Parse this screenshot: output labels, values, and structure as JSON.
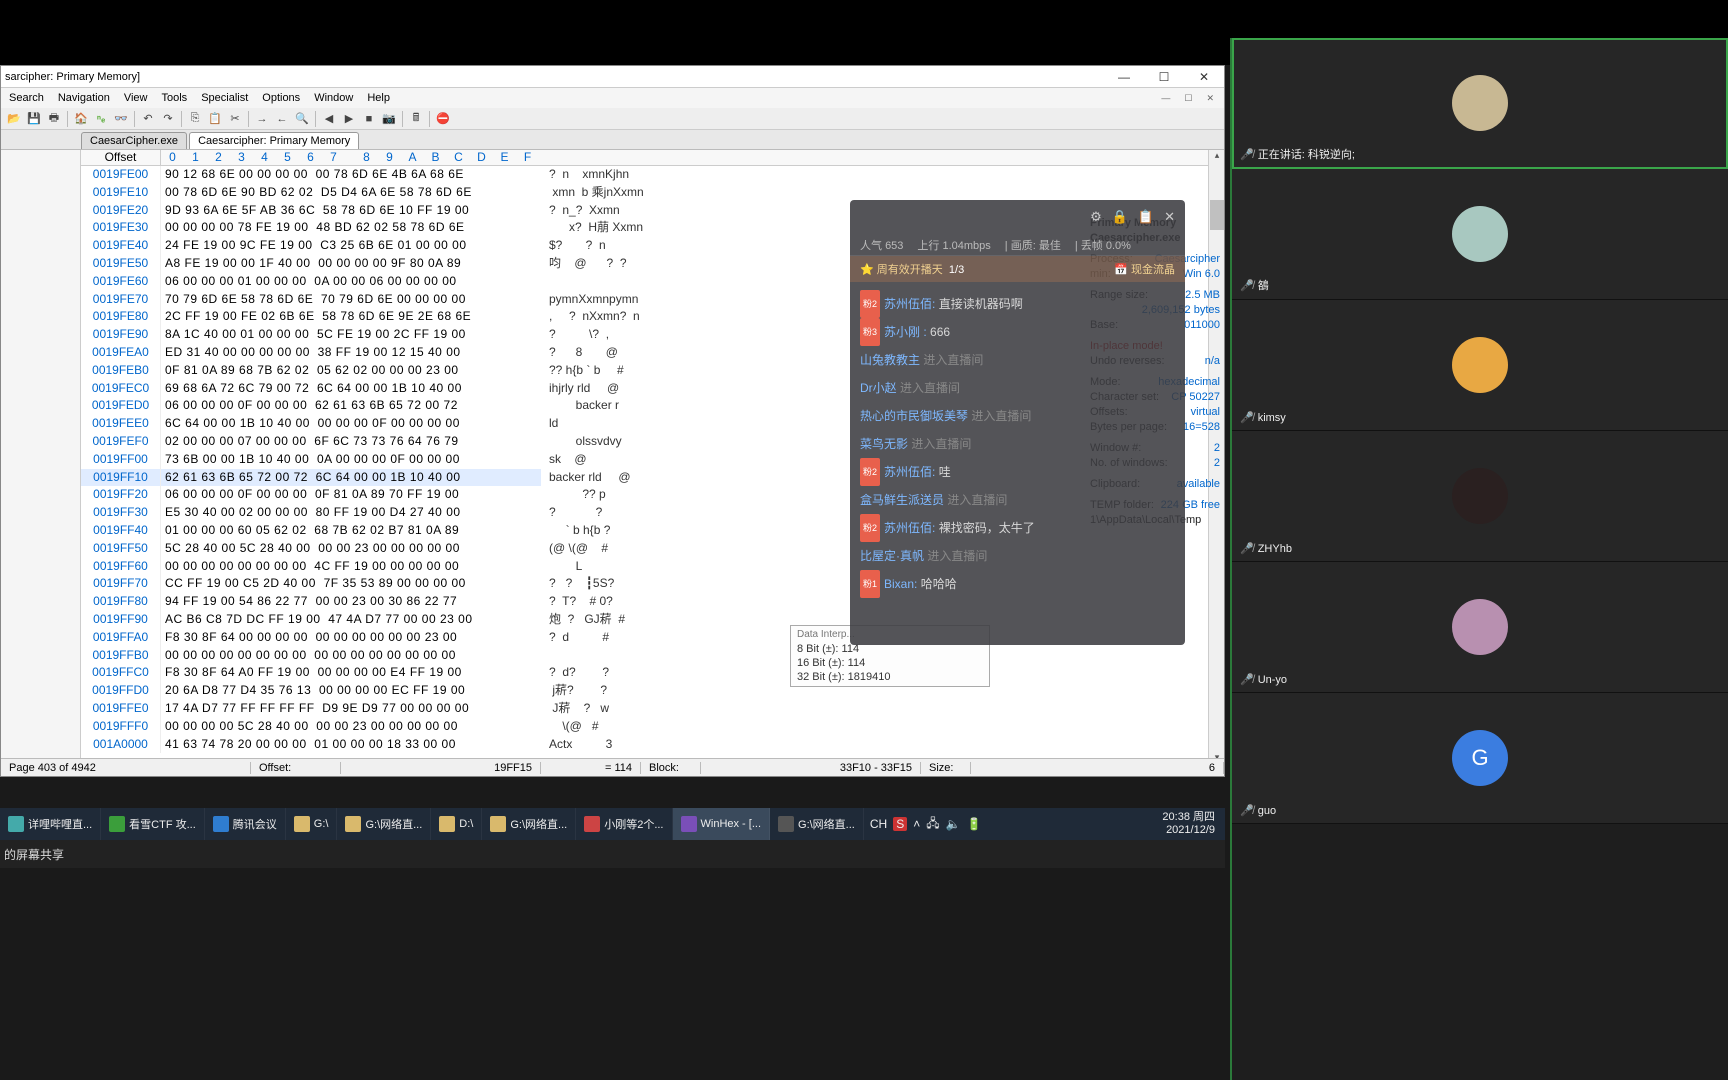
{
  "window": {
    "title": "sarcipher: Primary Memory]",
    "minimize": "—",
    "maximize": "☐",
    "close": "✕"
  },
  "menu": [
    "Search",
    "Navigation",
    "View",
    "Tools",
    "Specialist",
    "Options",
    "Window",
    "Help"
  ],
  "tabs": [
    {
      "label": "CaesarCipher.exe",
      "active": false
    },
    {
      "label": "Caesarcipher: Primary Memory",
      "active": true
    }
  ],
  "hex_header": {
    "offset": "Offset",
    "cols": [
      "0",
      "1",
      "2",
      "3",
      "4",
      "5",
      "6",
      "7",
      "8",
      "9",
      "A",
      "B",
      "C",
      "D",
      "E",
      "F"
    ]
  },
  "hex_rows": [
    {
      "off": "0019FE00",
      "b": "90 12 68 6E 00 00 00 00  00 78 6D 6E 4B 6A 68 6E",
      "a": "?  n    xmnKjhn"
    },
    {
      "off": "0019FE10",
      "b": "00 78 6D 6E 90 BD 62 02  D5 D4 6A 6E 58 78 6D 6E",
      "a": " xmn  b 乘jnXxmn"
    },
    {
      "off": "0019FE20",
      "b": "9D 93 6A 6E 5F AB 36 6C  58 78 6D 6E 10 FF 19 00",
      "a": "?  n_?  Xxmn"
    },
    {
      "off": "0019FE30",
      "b": "00 00 00 00 78 FE 19 00  48 BD 62 02 58 78 6D 6E",
      "a": "      x?  H萠 Xxmn"
    },
    {
      "off": "0019FE40",
      "b": "24 FE 19 00 9C FE 19 00  C3 25 6B 6E 01 00 00 00",
      "a": "$?       ?  n"
    },
    {
      "off": "0019FE50",
      "b": "A8 FE 19 00 00 1F 40 00  00 00 00 00 9F 80 0A 89",
      "a": "呁    @      ?  ?"
    },
    {
      "off": "0019FE60",
      "b": "06 00 00 00 01 00 00 00  0A 00 00 06 00 00 00 00",
      "a": ""
    },
    {
      "off": "0019FE70",
      "b": "70 79 6D 6E 58 78 6D 6E  70 79 6D 6E 00 00 00 00",
      "a": "pymnXxmnpymn"
    },
    {
      "off": "0019FE80",
      "b": "2C FF 19 00 FE 02 6B 6E  58 78 6D 6E 9E 2E 68 6E",
      "a": ",     ?  nXxmn?  n"
    },
    {
      "off": "0019FE90",
      "b": "8A 1C 40 00 01 00 00 00  5C FE 19 00 2C FF 19 00",
      "a": "?          \\?  ,"
    },
    {
      "off": "0019FEA0",
      "b": "ED 31 40 00 00 00 00 00  38 FF 19 00 12 15 40 00",
      "a": "?      8       @"
    },
    {
      "off": "0019FEB0",
      "b": "0F 81 0A 89 68 7B 62 02  05 62 02 00 00 00 23 00",
      "a": "?? h{b ` b     #"
    },
    {
      "off": "0019FEC0",
      "b": "69 68 6A 72 6C 79 00 72  6C 64 00 00 1B 10 40 00",
      "a": "ihjrly rld     @"
    },
    {
      "off": "0019FED0",
      "b": "06 00 00 00 0F 00 00 00  62 61 63 6B 65 72 00 72",
      "a": "        backer r"
    },
    {
      "off": "0019FEE0",
      "b": "6C 64 00 00 1B 10 40 00  00 00 00 0F 00 00 00 00",
      "a": "ld"
    },
    {
      "off": "0019FEF0",
      "b": "02 00 00 00 07 00 00 00  6F 6C 73 73 76 64 76 79",
      "a": "        olssvdvy"
    },
    {
      "off": "0019FF00",
      "b": "73 6B 00 00 1B 10 40 00  0A 00 00 00 0F 00 00 00",
      "a": "sk    @"
    },
    {
      "off": "0019FF10",
      "b": "62 61 63 6B 65 72 00 72  6C 64 00 00 1B 10 40 00",
      "a": "backer rld     @",
      "sel": true
    },
    {
      "off": "0019FF20",
      "b": "06 00 00 00 0F 00 00 00  0F 81 0A 89 70 FF 19 00",
      "a": "          ?? p"
    },
    {
      "off": "0019FF30",
      "b": "E5 30 40 00 02 00 00 00  80 FF 19 00 D4 27 40 00",
      "a": "?            ?"
    },
    {
      "off": "0019FF40",
      "b": "01 00 00 00 60 05 62 02  68 7B 62 02 B7 81 0A 89",
      "a": "     ` b h{b ?"
    },
    {
      "off": "0019FF50",
      "b": "5C 28 40 00 5C 28 40 00  00 00 23 00 00 00 00 00",
      "a": "(@ \\(@    #"
    },
    {
      "off": "0019FF60",
      "b": "00 00 00 00 00 00 00 00  4C FF 19 00 00 00 00 00",
      "a": "        L"
    },
    {
      "off": "0019FF70",
      "b": "CC FF 19 00 C5 2D 40 00  7F 35 53 89 00 00 00 00",
      "a": "?   ?    ┇5S?"
    },
    {
      "off": "0019FF80",
      "b": "94 FF 19 00 54 86 22 77  00 00 23 00 30 86 22 77",
      "a": "?  T?    # 0?"
    },
    {
      "off": "0019FF90",
      "b": "AC B6 C8 7D DC FF 19 00  47 4A D7 77 00 00 23 00",
      "a": "炮  ?   GJ菥  #"
    },
    {
      "off": "0019FFA0",
      "b": "F8 30 8F 64 00 00 00 00  00 00 00 00 00 00 23 00",
      "a": "?  d          #"
    },
    {
      "off": "0019FFB0",
      "b": "00 00 00 00 00 00 00 00  00 00 00 00 00 00 00 00",
      "a": ""
    },
    {
      "off": "0019FFC0",
      "b": "F8 30 8F 64 A0 FF 19 00  00 00 00 00 E4 FF 19 00",
      "a": "?  d?        ?"
    },
    {
      "off": "0019FFD0",
      "b": "20 6A D8 77 D4 35 76 13  00 00 00 00 EC FF 19 00",
      "a": " j菥?        ?"
    },
    {
      "off": "0019FFE0",
      "b": "17 4A D7 77 FF FF FF FF  D9 9E D9 77 00 00 00 00",
      "a": " J菥    ?   w"
    },
    {
      "off": "0019FFF0",
      "b": "00 00 00 00 5C 28 40 00  00 00 23 00 00 00 00 00",
      "a": "    \\(@   #"
    },
    {
      "off": "001A0000",
      "b": "41 63 74 78 20 00 00 00  01 00 00 00 18 33 00 00",
      "a": "Actx          3"
    }
  ],
  "info_panel": {
    "title1": "Primary Memory",
    "title2": "Caesarcipher.exe",
    "process_k": "Process:",
    "process_v": "Caesarcipher",
    "win_k": "min:",
    "win_v": "Win 6.0",
    "range_k": "Range size:",
    "range_v": "2.5 MB",
    "range_v2": "2,609,152 bytes",
    "base_k": "Base:",
    "base_v": "011000",
    "inplace": "In-place mode!",
    "undo_k": "Undo reverses:",
    "undo_v": "n/a",
    "mode_k": "Mode:",
    "mode_v": "hexadecimal",
    "charset_k": "Character set:",
    "charset_v": "CP 50227",
    "offsets_k": "Offsets:",
    "offsets_v": "virtual",
    "bpp_k": "Bytes per page:",
    "bpp_v": "16=528",
    "winnum_k": "Window #:",
    "winnum_v": "2",
    "nwins_k": "No. of windows:",
    "nwins_v": "2",
    "clip_k": "Clipboard:",
    "clip_v": "available",
    "temp_k": "TEMP folder:",
    "temp_v": "224 GB free",
    "temp_v2": "1\\AppData\\Local\\Temp"
  },
  "data_interpreter": {
    "header": "Data Interp...",
    "l1": "8 Bit (±): 114",
    "l2": "16 Bit (±): 114",
    "l3": "32 Bit (±): 1819410"
  },
  "status": {
    "page": "Page 403 of 4942",
    "offset_k": "Offset:",
    "offset_v": "19FF15",
    "val": "= 114",
    "block_k": "Block:",
    "block_v": "33F10 - 33F15",
    "size_k": "Size:",
    "size_v": "6"
  },
  "chat": {
    "top_icons": [
      "⚙",
      "🔒",
      "📋",
      "✕"
    ],
    "stat": {
      "popularity_k": "人气",
      "popularity_v": "653",
      "up_k": "上行",
      "up_v": "1.04mbps",
      "qual_k": "画质:",
      "qual_v": "最佳",
      "drop_k": "丢帧",
      "drop_v": "0.0%"
    },
    "banner": {
      "text": "⭐ 周有效开播天",
      "count": "1/3",
      "btn": "📅 现金流晶"
    },
    "messages": [
      {
        "badge": "粉2",
        "user": "苏州伍佰:",
        "text": "直接读机器码啊",
        "type": "msg"
      },
      {
        "badge": "粉3",
        "user": "苏小刚 :",
        "text": "666",
        "type": "msg"
      },
      {
        "user": "山兔教教主",
        "text": "进入直播间",
        "type": "sys"
      },
      {
        "user": "Dr小赵",
        "text": "进入直播间",
        "type": "sys"
      },
      {
        "user": "热心的市民御坂美琴",
        "text": "进入直播间",
        "type": "sys"
      },
      {
        "user": "菜鸟无影",
        "text": "进入直播间",
        "type": "sys"
      },
      {
        "badge": "粉2",
        "user": "苏州伍佰:",
        "text": "哇",
        "type": "msg"
      },
      {
        "user": "盒马鲜生派送员",
        "text": "进入直播间",
        "type": "sys"
      },
      {
        "badge": "粉2",
        "user": "苏州伍佰:",
        "text": "裸找密码，太牛了",
        "type": "msg"
      },
      {
        "user": "比屋定·真帆",
        "text": "进入直播间",
        "type": "sys"
      },
      {
        "badge": "粉1",
        "user": "Bixan:",
        "text": "哈哈哈",
        "type": "msg"
      }
    ]
  },
  "taskbar": {
    "items": [
      {
        "label": "详哩哔哩直...",
        "color": "#4aa"
      },
      {
        "label": "看雪CTF 攻...",
        "color": "#3b9e3b"
      },
      {
        "label": "腾讯会议",
        "color": "#2f7dd0"
      },
      {
        "label": "G:\\",
        "color": "#d9b96c"
      },
      {
        "label": "G:\\网络直...",
        "color": "#d9b96c"
      },
      {
        "label": "D:\\",
        "color": "#d9b96c"
      },
      {
        "label": "G:\\网络直...",
        "color": "#d9b96c"
      },
      {
        "label": "小刚等2个...",
        "color": "#c44"
      },
      {
        "label": "WinHex - [...",
        "color": "#7a4fb8",
        "active": true
      },
      {
        "label": "G:\\网络直...",
        "color": "#555"
      }
    ],
    "ime": "CH",
    "ime2": "S",
    "clock_time": "20:38 周四",
    "clock_date": "2021/12/9"
  },
  "share_bar": "的屏幕共享",
  "participants": [
    {
      "name": "正在讲话: 科锐逆向;",
      "color": "#c8b893",
      "speaking": true
    },
    {
      "name": "鵅",
      "color": "#a8c8c0"
    },
    {
      "name": "kimsy",
      "color": "#e8a843"
    },
    {
      "name": "ZHYhb",
      "color": "#2a2020"
    },
    {
      "name": "Un-yo",
      "color": "#b890b0"
    },
    {
      "name": "guo",
      "color": "#3b7de0",
      "initial": "G"
    }
  ]
}
